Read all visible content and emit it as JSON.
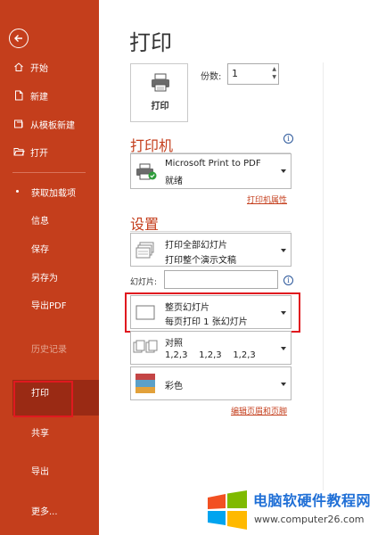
{
  "sidebar": {
    "items": [
      {
        "label": "开始"
      },
      {
        "label": "新建"
      },
      {
        "label": "从模板新建"
      },
      {
        "label": "打开"
      },
      {
        "label": "获取加载项"
      },
      {
        "label": "信息"
      },
      {
        "label": "保存"
      },
      {
        "label": "另存为"
      },
      {
        "label": "导出PDF"
      },
      {
        "label": "历史记录"
      },
      {
        "label": "打印"
      },
      {
        "label": "共享"
      },
      {
        "label": "导出"
      },
      {
        "label": "更多..."
      }
    ]
  },
  "main": {
    "title": "打印",
    "print_button_label": "打印",
    "copies_label": "份数:",
    "copies_value": "1",
    "printer_section": "打印机",
    "printer_name": "Microsoft Print to PDF",
    "printer_status": "就绪",
    "printer_properties": "打印机属性",
    "settings_section": "设置",
    "range_line1": "打印全部幻灯片",
    "range_line2": "打印整个演示文稿",
    "slides_label": "幻灯片:",
    "layout_line1": "整页幻灯片",
    "layout_line2": "每页打印 1 张幻灯片",
    "collate_label": "对照",
    "collate_order": "1,2,3    1,2,3    1,2,3",
    "color_label": "彩色",
    "edit_header_footer": "编辑页眉和页脚"
  },
  "watermark": {
    "title": "电脑软硬件教程网",
    "url": "www.computer26.com"
  },
  "colors": {
    "accent": "#c43e1c",
    "highlight_box": "#e0191f",
    "link_blue": "#2b579a"
  }
}
